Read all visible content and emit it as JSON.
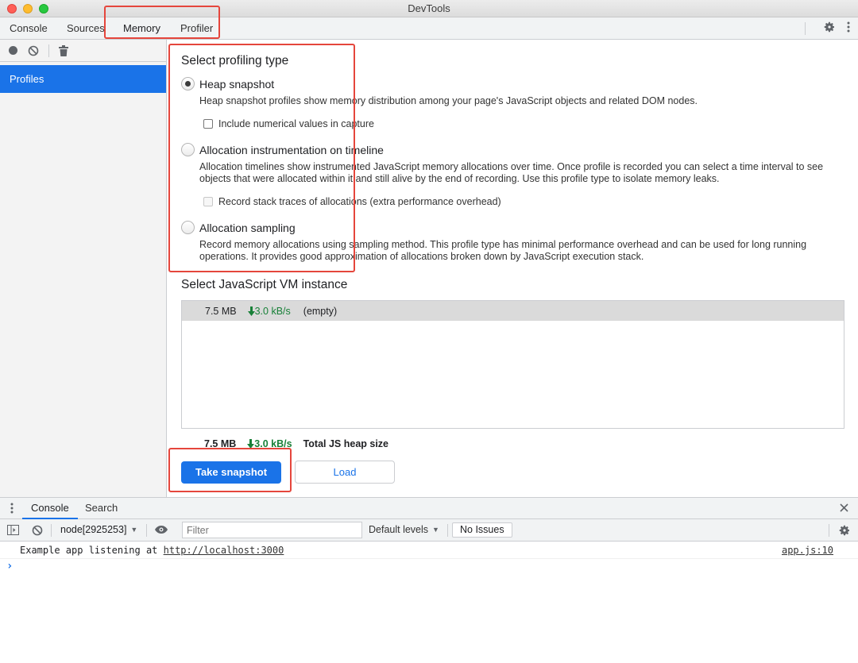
{
  "window": {
    "title": "DevTools"
  },
  "tabs": [
    {
      "label": "Console"
    },
    {
      "label": "Sources"
    },
    {
      "label": "Memory",
      "active": true
    },
    {
      "label": "Profiler"
    }
  ],
  "sidebar": {
    "items": [
      {
        "label": "Profiles",
        "selected": true
      }
    ]
  },
  "profiling": {
    "heading": "Select profiling type",
    "options": [
      {
        "label": "Heap snapshot",
        "checked": true,
        "description": "Heap snapshot profiles show memory distribution among your page's JavaScript objects and related DOM nodes.",
        "sub_option": {
          "label": "Include numerical values in capture",
          "checked": false,
          "enabled": true
        }
      },
      {
        "label": "Allocation instrumentation on timeline",
        "checked": false,
        "description": "Allocation timelines show instrumented JavaScript memory allocations over time. Once profile is recorded you can select a time interval to see objects that were allocated within it and still alive by the end of recording. Use this profile type to isolate memory leaks.",
        "sub_option": {
          "label": "Record stack traces of allocations (extra performance overhead)",
          "checked": false,
          "enabled": false
        }
      },
      {
        "label": "Allocation sampling",
        "checked": false,
        "description": "Record memory allocations using sampling method. This profile type has minimal performance overhead and can be used for long running operations. It provides good approximation of allocations broken down by JavaScript execution stack."
      }
    ]
  },
  "vm": {
    "heading": "Select JavaScript VM instance",
    "instances": [
      {
        "size": "7.5 MB",
        "rate": "3.0 kB/s",
        "name": "(empty)"
      }
    ],
    "summary": {
      "size": "7.5 MB",
      "rate": "3.0 kB/s",
      "label": "Total JS heap size"
    }
  },
  "buttons": {
    "take_snapshot": "Take snapshot",
    "load": "Load"
  },
  "drawer": {
    "tabs": [
      {
        "label": "Console",
        "active": true
      },
      {
        "label": "Search"
      }
    ],
    "context": "node[2925253]",
    "filter_placeholder": "Filter",
    "levels": "Default levels",
    "issues": "No Issues",
    "log": {
      "text": "Example app listening at ",
      "link": "http://localhost:3000",
      "source": "app.js:10"
    },
    "prompt": "›"
  },
  "colors": {
    "accent": "#1a73e8",
    "annotation": "#e5463c",
    "rate_green": "#188038"
  }
}
